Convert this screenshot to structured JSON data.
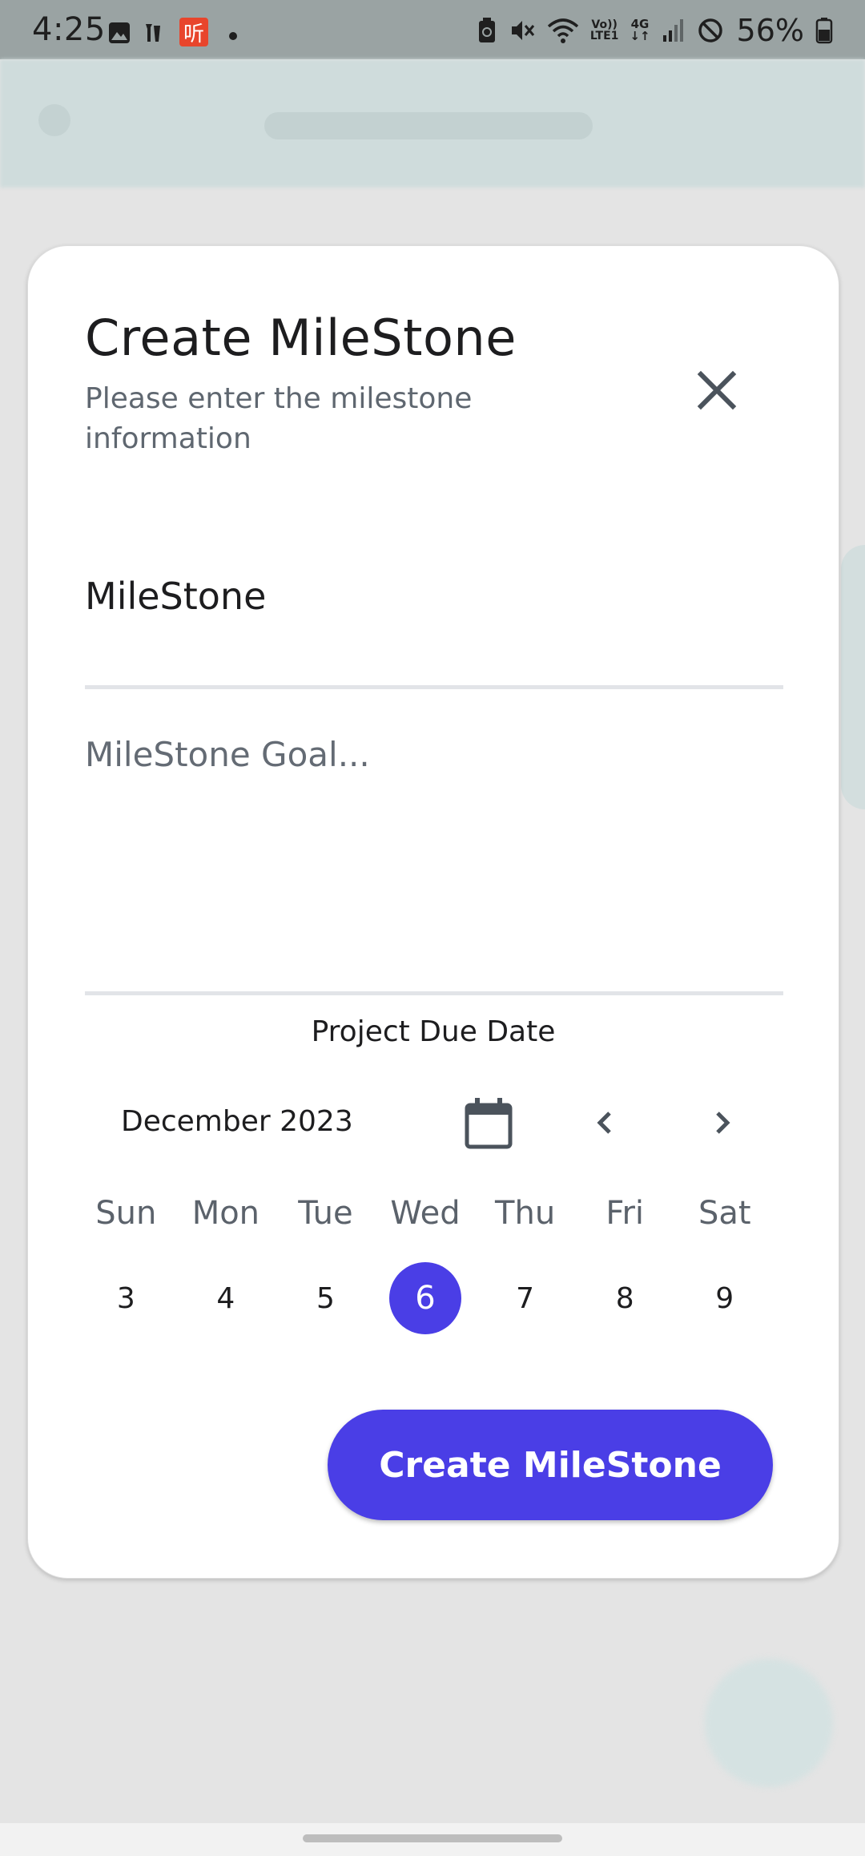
{
  "status_bar": {
    "time": "4:25",
    "battery_percent": "56%",
    "network": "4G",
    "volte": "LTE1",
    "icons": [
      "image-icon",
      "news-icon",
      "listen-app-icon",
      "dot-icon",
      "battery-saver-icon",
      "mute-icon",
      "wifi-icon",
      "volte-icon",
      "4g-icon",
      "signal-icon",
      "block-icon",
      "battery-icon"
    ],
    "app_badge": "听"
  },
  "dialog": {
    "title": "Create MileStone",
    "subtitle": "Please enter the milestone information",
    "name_field": {
      "value": "MileStone"
    },
    "goal_field": {
      "placeholder": "MileStone Goal..."
    },
    "due_date": {
      "label": "Project Due Date",
      "month": "December 2023",
      "weekdays": [
        "Sun",
        "Mon",
        "Tue",
        "Wed",
        "Thu",
        "Fri",
        "Sat"
      ],
      "days": [
        "3",
        "4",
        "5",
        "6",
        "7",
        "8",
        "9"
      ],
      "selected_day": "6"
    },
    "create_button": "Create MileStone"
  },
  "colors": {
    "accent": "#4a3ee6",
    "status_bar_bg": "#9aa3a3",
    "overlay_bg": "#e4e4e4"
  }
}
